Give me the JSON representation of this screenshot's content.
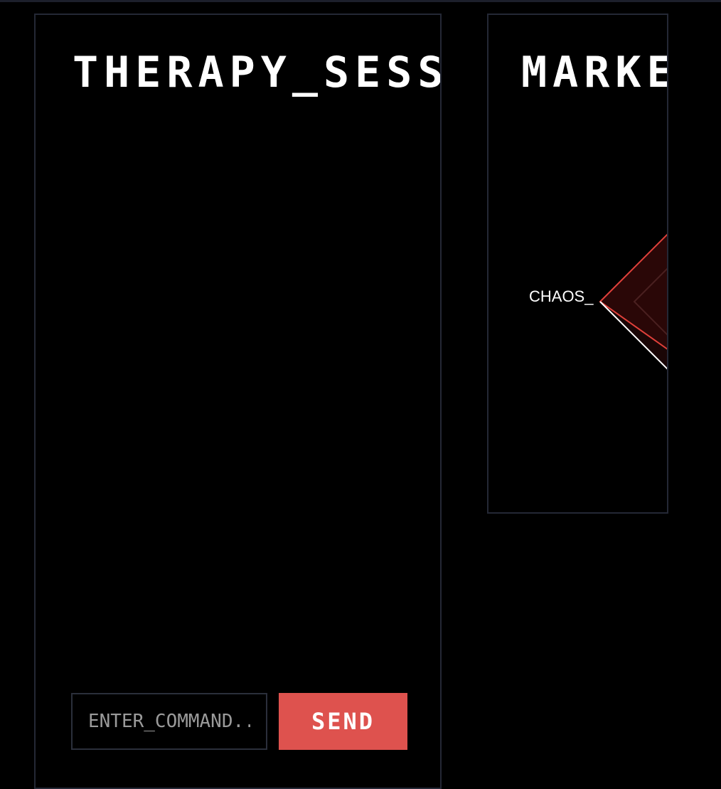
{
  "therapy": {
    "title": "THERAPY_SESSION",
    "input_placeholder": "ENTER_COMMAND...",
    "send_label": "SEND"
  },
  "market": {
    "title": "MARKET",
    "radar_label_left": "CHAOS_"
  },
  "colors": {
    "background": "#000000",
    "border": "#242835",
    "accent": "#de524e",
    "radar_fill": "#2a0707",
    "radar_stroke": "#e0403a",
    "text": "#ffffff"
  }
}
